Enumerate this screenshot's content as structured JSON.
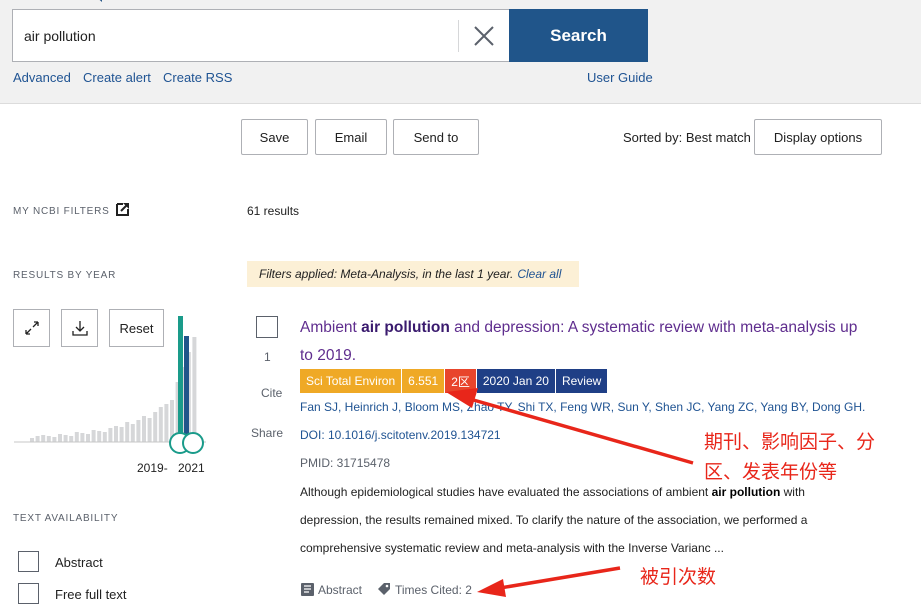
{
  "search": {
    "query": "air pollution",
    "button_label": "Search",
    "links": [
      "Advanced",
      "Create alert",
      "Create RSS"
    ],
    "user_guide": "User Guide"
  },
  "toolbar": {
    "save": "Save",
    "email": "Email",
    "send_to": "Send to",
    "sorted_by": "Sorted by: Best match",
    "display_options": "Display options"
  },
  "sidebar": {
    "my_filters": "MY NCBI FILTERS",
    "results_by_year": "RESULTS BY YEAR",
    "reset": "Reset",
    "year_start": "2019-",
    "year_end": "2021",
    "text_availability": "TEXT AVAILABILITY",
    "filters": [
      "Abstract",
      "Free full text"
    ]
  },
  "results": {
    "count": "61 results",
    "filters_applied": "Filters applied: Meta-Analysis, in the last 1 year.",
    "clear_all": "Clear all",
    "item": {
      "number": "1",
      "cite": "Cite",
      "share": "Share",
      "title_pre": "Ambient ",
      "title_bold": "air pollution",
      "title_post": " and depression: A systematic review with meta-analysis up to 2019.",
      "tags": [
        {
          "text": "Sci Total Environ",
          "color": "#efa926"
        },
        {
          "text": "6.551",
          "color": "#efa926"
        },
        {
          "text": "2区",
          "color": "#e8452c"
        },
        {
          "text": "2020 Jan 20",
          "color": "#1f3f86"
        },
        {
          "text": "Review",
          "color": "#1f3f86"
        }
      ],
      "authors": "Fan SJ, Heinrich J, Bloom MS, Zhao TY, Shi TX, Feng WR, Sun Y, Shen JC, Yang ZC, Yang BY, Dong GH.",
      "doi": "DOI: 10.1016/j.scitotenv.2019.134721",
      "pmid": "PMID: 31715478",
      "abstract_pre": "Although epidemiological studies have evaluated the associations of ambient ",
      "abstract_bold": "air pollution",
      "abstract_post": " with depression, the results remained mixed. To clarify the nature of the association, we performed a comprehensive systematic review and meta-analysis with the Inverse Varianc ...",
      "abstract_link": "Abstract",
      "times_cited": "Times Cited: 2"
    }
  },
  "annotations": {
    "note1_line1": "期刊、影响因子、分",
    "note1_line2": "区、发表年份等",
    "note2": "被引次数",
    "color": "#e8261a"
  },
  "colors": {
    "accent": "#20558a",
    "link": "#205493",
    "title": "#5f2d8e",
    "bar": "#d6d7d9",
    "bar_selected_teal": "#1a9b8a",
    "bar_selected_blue": "#20558a"
  }
}
